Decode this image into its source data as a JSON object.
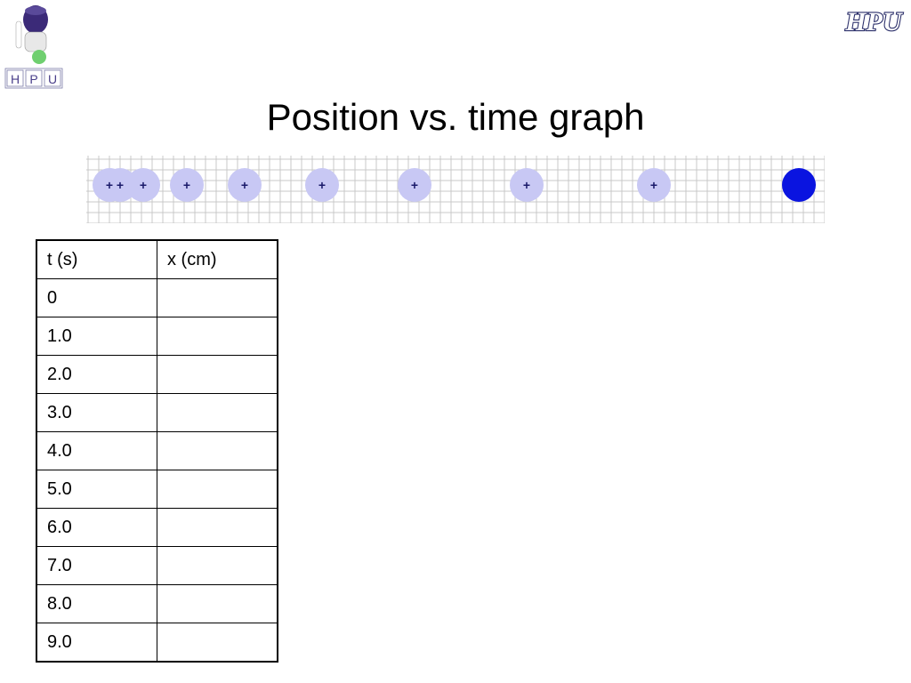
{
  "header": {
    "title": "Position vs. time graph"
  },
  "logos": {
    "left_letters": [
      "H",
      "P",
      "U"
    ],
    "right_text": "HPU"
  },
  "motion_strip": {
    "marker_symbol": "+",
    "marker_count": 8,
    "ghost_color": "#c8c8f4",
    "final_color": "#0a14e0"
  },
  "table": {
    "headers": [
      "t (s)",
      "x (cm)"
    ],
    "rows": [
      [
        "0",
        ""
      ],
      [
        "1.0",
        ""
      ],
      [
        "2.0",
        ""
      ],
      [
        "3.0",
        ""
      ],
      [
        "4.0",
        ""
      ],
      [
        "5.0",
        ""
      ],
      [
        "6.0",
        ""
      ],
      [
        "7.0",
        ""
      ],
      [
        "8.0",
        ""
      ],
      [
        "9.0",
        ""
      ]
    ]
  }
}
